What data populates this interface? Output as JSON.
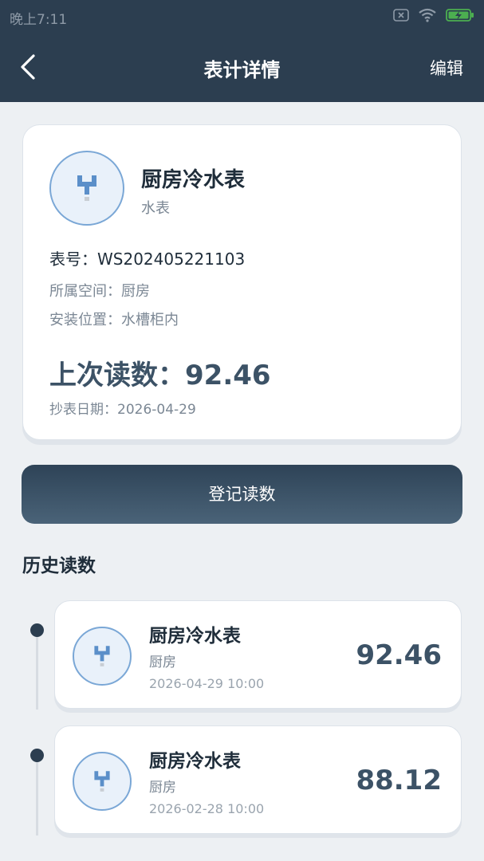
{
  "status_bar": {
    "time": "晚上7:11",
    "icons": [
      "sim-off-icon",
      "wifi-icon",
      "battery-charging-icon"
    ]
  },
  "nav": {
    "title": "表计详情",
    "edit_label": "编辑",
    "back_icon": "back-arrow-icon"
  },
  "detail": {
    "icon": "water-tap-icon",
    "name": "厨房冷水表",
    "type": "水表",
    "meter_no": "表号：WS202405221103",
    "space": "所属空间：厨房",
    "location": "安装位置：水槽柜内",
    "last_reading": "上次读数：92.46",
    "read_date": "抄表日期：2026-04-29"
  },
  "register_button": "登记读数",
  "history": {
    "title": "历史读数",
    "items": [
      {
        "name": "厨房冷水表",
        "space": "厨房",
        "time": "2026-04-29 10:00",
        "value": "92.46"
      },
      {
        "name": "厨房冷水表",
        "space": "厨房",
        "time": "2026-02-28 10:00",
        "value": "88.12"
      }
    ]
  },
  "colors": {
    "header": "#2c3e50",
    "background": "#edf0f3",
    "accent": "#7aa7d6",
    "value_text": "#3c5266"
  }
}
